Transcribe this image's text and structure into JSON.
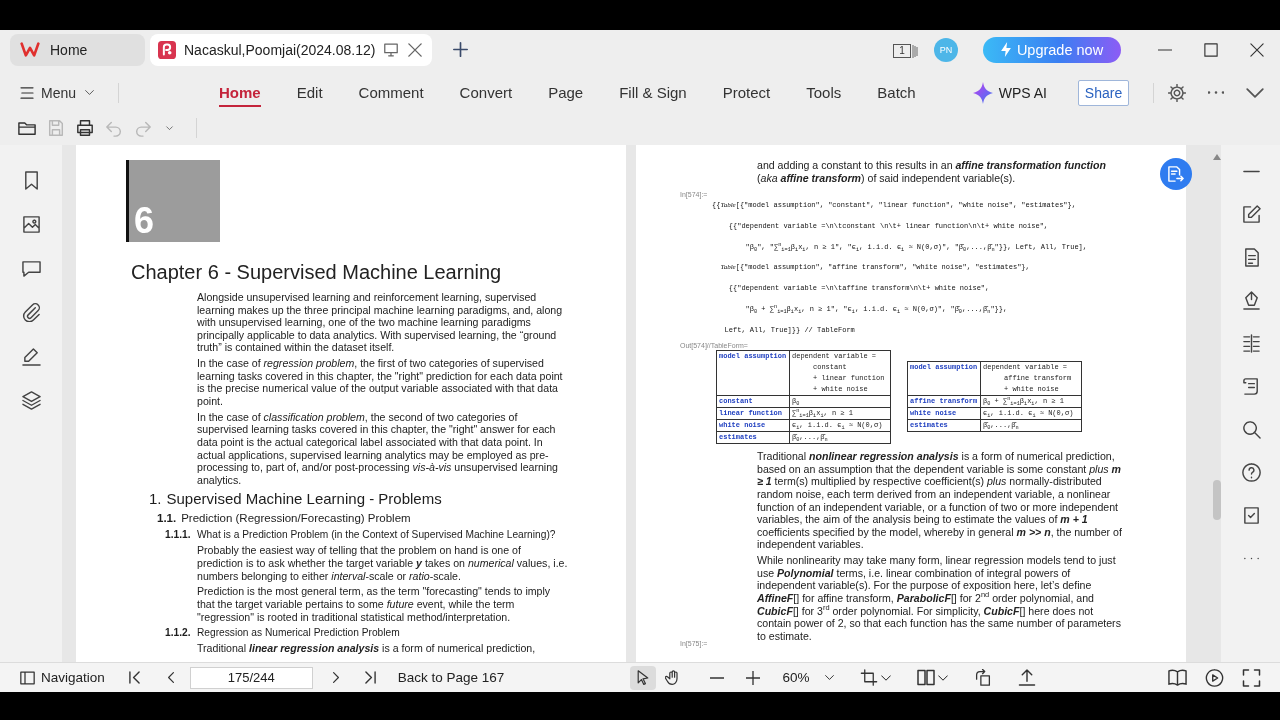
{
  "window": {
    "tabs": [
      {
        "kind": "home",
        "label": "Home",
        "selected": false
      },
      {
        "kind": "document",
        "label": "Nacaskul,Poomjai(2024.08.12)",
        "selected": true
      }
    ],
    "window_count": "1",
    "avatar": "PN",
    "upgrade_button": "Upgrade now"
  },
  "ribbon": {
    "menu": "Menu",
    "tabs": [
      {
        "label": "Home",
        "selected": true
      },
      {
        "label": "Edit",
        "selected": false
      },
      {
        "label": "Comment",
        "selected": false
      },
      {
        "label": "Convert",
        "selected": false
      },
      {
        "label": "Page",
        "selected": false
      },
      {
        "label": "Fill & Sign",
        "selected": false
      },
      {
        "label": "Protect",
        "selected": false
      },
      {
        "label": "Tools",
        "selected": false
      },
      {
        "label": "Batch",
        "selected": false
      }
    ],
    "ai_button": "WPS AI",
    "share_button": "Share"
  },
  "quick_toolbar": [
    {
      "kind": "open",
      "disabled": false
    },
    {
      "kind": "save",
      "disabled": true
    },
    {
      "kind": "print",
      "disabled": false
    },
    {
      "kind": "undo",
      "disabled": true
    },
    {
      "kind": "redo",
      "disabled": true
    },
    {
      "kind": "more",
      "disabled": false
    }
  ],
  "document": {
    "pages": [
      {
        "blocks": [
          {
            "kind": "number",
            "text": "6"
          },
          {
            "kind": "title",
            "text": "Chapter 6 - Supervised Machine Learning"
          },
          {
            "kind": "paragraph",
            "text": "Alongside unsupervised learning and reinforcement learning, supervised learning makes up the three principal machine learning paradigms, and, along with unsupervised learning, one of the two machine learning paradigms principally applicable to data analytics. With supervised learning, the “ground truth” is contained within the dataset itself."
          },
          {
            "kind": "paragraph",
            "text": "In the case of *regression problem*, the first of two categories of supervised learning tasks covered in this chapter, the \"right\" prediction for each data point is the precise numerical value of the output variable associated with that data point."
          },
          {
            "kind": "paragraph",
            "text": "In the case of *classification problem*, the second of two categories of supervised learning tasks covered in this chapter, the \"right\" answer for each data point is the actual categorical label associated with that data point. In actual applications, supervised learning analytics may be employed as pre-processing to, part of, and/or post-processing *vis-à-vis* unsupervised learning analytics."
          },
          {
            "kind": "section",
            "number": "1.",
            "text": "Supervised Machine Learning - Problems"
          },
          {
            "kind": "subsection",
            "number": "1.1.",
            "text": "Prediction (Regression/Forecasting) Problem"
          },
          {
            "kind": "subsubsection",
            "number": "1.1.1.",
            "text": "What is a Prediction Problem (in the Context of Supervised Machine Learning)?"
          },
          {
            "kind": "paragraph",
            "text": "Probably the easiest way of telling that the problem on hand is one of prediction is to ask whether the target variable **y** takes on *numerical* values, i.e. numbers belonging to either *interval*-scale or *ratio*-scale."
          },
          {
            "kind": "paragraph",
            "text": "Prediction is the most general term, as the term \"forecasting\" tends to imply that the target variable pertains to some *future* event, while the term \"regression\" is rooted in traditional statistical method/interpretation."
          },
          {
            "kind": "subsubsection",
            "number": "1.1.2.",
            "text": "Regression as Numerical Prediction Problem"
          },
          {
            "kind": "paragraph",
            "text": "Traditional **linear regression analysis** is a form of numerical prediction,"
          }
        ]
      },
      {
        "blocks": [
          {
            "kind": "paragraph",
            "text": "and adding a constant to this results in an **affine transformation function** (*aka* **affine transform**) of said independent variable(s)."
          },
          {
            "kind": "input",
            "label": "In[574]:=",
            "lines": [
              "{{*Table*[{\"model assumption\", \"constant\", \"linear function\", \"white noise\", \"estimates\"},",
              "    {{\"dependent variable =\\n\\tconstant \\n\\t+ linear function\\n\\t+ white noise\",",
              "        \"β$_{0}$\", \"∑$^{n}$$_{i=1}$β$_{i}$x$_{i}$, n ≥ 1\", \"ϵ$_{i}$, i.i.d. ϵ$_{i}$ ≈ N(0,σ)\", \"β̂$_{0}$,...,β̂$_{n}$\"}}, Left, All, True],",
              "  *Table*[{\"model assumption\", \"affine transform\", \"white noise\", \"estimates\"},",
              "    {{\"dependent variable =\\n\\taffine transform\\n\\t+ white noise\",",
              "        \"β$_{0}$ + ∑$^{n}$$_{i=1}$β$_{i}$x$_{i}$, n ≥ 1\", \"ϵ$_{i}$, i.i.d. ϵ$_{i}$ ≈ N(0,σ)\", \"β̂$_{0}$,...,β̂$_{n}$\"}},",
              "   Left, All, True]}} // TableForm"
            ]
          },
          {
            "kind": "output",
            "label": "Out[574]//TableForm=",
            "tables": [
              {
                "header": {
                  "label": "model assumption",
                  "lines": [
                    "dependent variable =",
                    "constant",
                    "+ linear function",
                    "+ white noise"
                  ]
                },
                "rows": [
                  {
                    "label": "constant",
                    "value": "β$_{0}$"
                  },
                  {
                    "label": "linear function",
                    "value": "∑$^{n}$$_{i=1}$β$_{i}$x$_{i}$, n ≥ 1"
                  },
                  {
                    "label": "white noise",
                    "value": "ϵ$_{i}$, i.i.d. ϵ$_{i}$ ≈ N(0,σ)"
                  },
                  {
                    "label": "estimates",
                    "value": "β̂$_{0}$,...,β̂$_{n}$"
                  }
                ]
              },
              {
                "header": {
                  "label": "model assumption",
                  "lines": [
                    "dependent variable =",
                    "affine transform",
                    "+ white noise"
                  ]
                },
                "rows": [
                  {
                    "label": "affine transform",
                    "value": "β$_{0}$ + ∑$^{n}$$_{i=1}$β$_{i}$x$_{i}$, n ≥ 1"
                  },
                  {
                    "label": "white noise",
                    "value": "ϵ$_{i}$, i.i.d. ϵ$_{i}$ ≈ N(0,σ)"
                  },
                  {
                    "label": "estimates",
                    "value": "β̂$_{0}$,...,β̂$_{n}$"
                  }
                ]
              }
            ]
          },
          {
            "kind": "paragraph",
            "text": "Traditional **nonlinear regression analysis** is a form of numerical prediction, based on an assumption that the dependent variable is some constant *plus* **m ≥ 1** term(s) multiplied by respective coefficient(s) *plus* normally-distributed random noise, each term derived from an independent variable, a nonlinear function of an independent variable, or a function of two or more independent variables, the aim of the analysis being to estimate the values of **m + 1** coefficients specified by the model, whereby in general **m >> n**, the number of independent variables."
          },
          {
            "kind": "paragraph",
            "text": "While nonlinearity may take many form, linear regression models tend to just use **Polynomial** terms, i.e. linear combination of integral powers of independent variable(s). For the purpose of exposition here, let’s define **AffineF**[] for affine transform, **ParabolicF**[] for 2$^{nd}$ order polynomial, and **CubicF**[] for 3$^{rd}$ order polynomial. For simplicity, **CubicF**[] here does not contain power of 2, so that each function has the same number of parameters to estimate."
          },
          {
            "kind": "input",
            "label": "In[575]:="
          }
        ]
      }
    ]
  },
  "status_bar": {
    "navigation": "Navigation",
    "page_field": "175/244",
    "back_link": "Back to Page 167",
    "tools": [
      {
        "kind": "select",
        "selected": true
      },
      {
        "kind": "hand",
        "selected": false
      }
    ],
    "zoom": "60%"
  }
}
